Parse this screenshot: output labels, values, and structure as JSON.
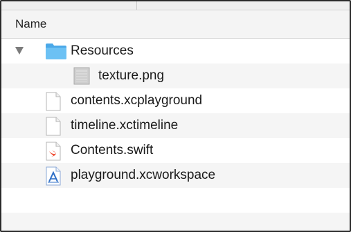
{
  "header": {
    "name_column": "Name"
  },
  "items": [
    {
      "label": "Resources",
      "icon": "folder-icon",
      "level": 0,
      "expanded": true
    },
    {
      "label": "texture.png",
      "icon": "image-file-icon",
      "level": 1
    },
    {
      "label": "contents.xcplayground",
      "icon": "document-icon",
      "level": 0
    },
    {
      "label": "timeline.xctimeline",
      "icon": "document-icon",
      "level": 0
    },
    {
      "label": "Contents.swift",
      "icon": "swift-file-icon",
      "level": 0
    },
    {
      "label": "playground.xcworkspace",
      "icon": "xcworkspace-icon",
      "level": 0
    }
  ],
  "colors": {
    "folder": "#5ab7f0",
    "swift": "#f05138",
    "workspace_blue": "#2e6fc7"
  }
}
